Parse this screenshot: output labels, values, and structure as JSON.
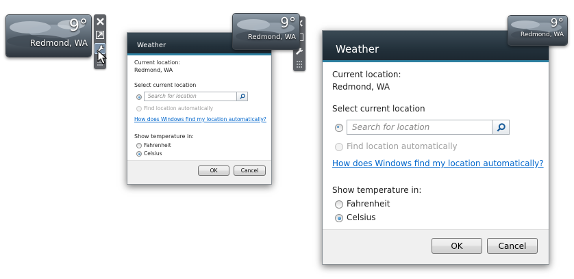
{
  "gadget": {
    "temperature": "9°",
    "location": "Redmond, WA",
    "condition_icon": "cloudy-sky-icon"
  },
  "toolbar": {
    "close_icon": "close-icon",
    "size_icon": "larger-size-icon",
    "options_icon": "wrench-options-icon",
    "drag_icon": "drag-grip-icon"
  },
  "dialog": {
    "title": "Weather",
    "current_location_label": "Current location:",
    "current_location_value": "Redmond, WA",
    "select_location_label": "Select current location",
    "search_placeholder": "Search for location",
    "find_auto_label": "Find location automatically",
    "help_link": "How does Windows find my location automatically?",
    "temperature_label": "Show temperature in:",
    "unit_options": [
      "Fahrenheit",
      "Celsius"
    ],
    "selected_unit": "Celsius",
    "ok_label": "OK",
    "cancel_label": "Cancel"
  },
  "colors": {
    "title_bar": "#22303a",
    "link": "#0066cc",
    "accent": "#2c7fa0"
  }
}
